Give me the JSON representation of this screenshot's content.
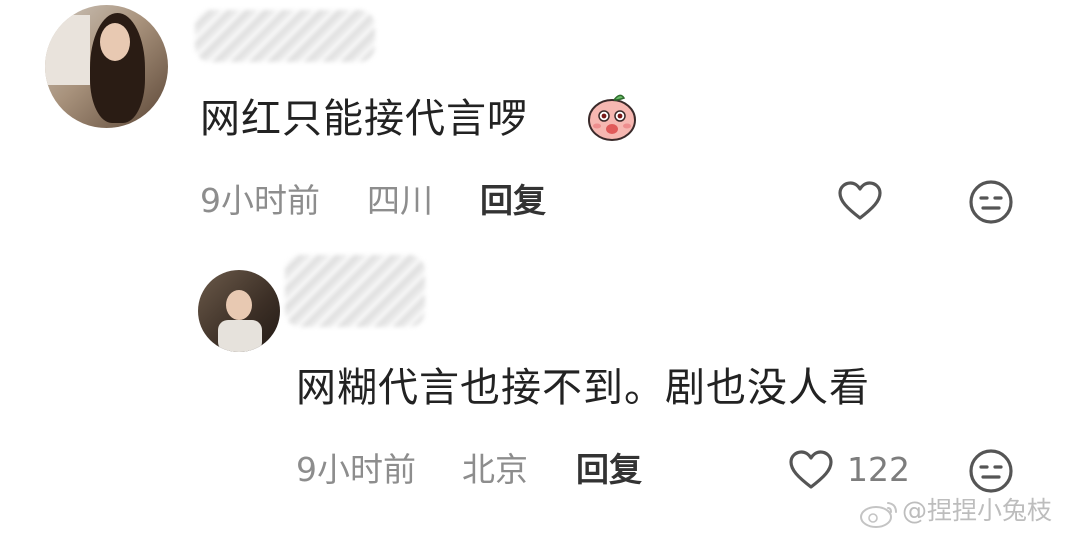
{
  "comments": [
    {
      "text": "网红只能接代言啰",
      "time": "9小时前",
      "location": "四川",
      "reply_label": "回复",
      "emoji_icon": "blushing-peach-emoji-icon"
    },
    {
      "text": "网糊代言也接不到。剧也没人看",
      "time": "9小时前",
      "location": "北京",
      "reply_label": "回复",
      "like_count": "122"
    }
  ],
  "watermark": "@捏捏小兔枝",
  "colors": {
    "text": "#222222",
    "meta": "#8d8d8d",
    "icon": "#555555"
  }
}
